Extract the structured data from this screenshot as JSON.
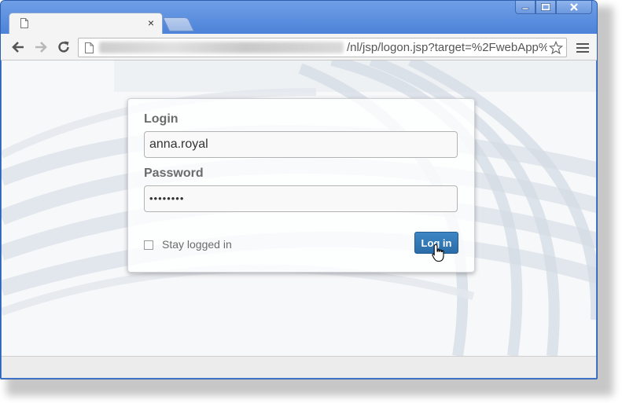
{
  "browser": {
    "tab_close": "×",
    "url_path": "/nl/jsp/logon.jsp?target=%2FwebApp%"
  },
  "login_form": {
    "login_label": "Login",
    "login_value": "anna.royal",
    "password_label": "Password",
    "password_value": "••••••••",
    "stay_logged_in_label": "Stay logged in",
    "stay_logged_in_checked": false,
    "submit_label": "Log in"
  },
  "colors": {
    "window_frame": "#4a80d6",
    "login_button": "#2f75b3"
  },
  "icons": [
    "page-icon",
    "close-icon",
    "back-arrow-icon",
    "forward-arrow-icon",
    "reload-icon",
    "star-icon",
    "menu-icon",
    "minimize-icon",
    "maximize-icon",
    "window-close-icon",
    "hand-cursor-icon"
  ]
}
